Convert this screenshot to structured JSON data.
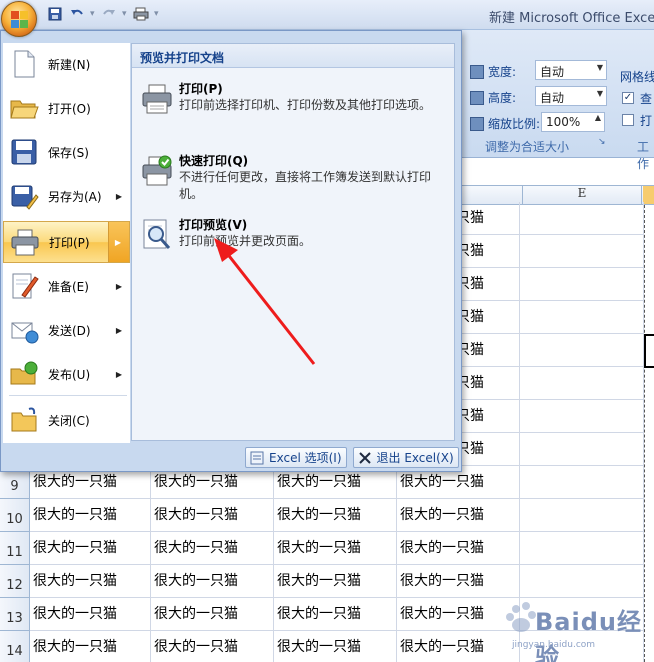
{
  "app": {
    "title": "新建 Microsoft Office Exce",
    "quick_access": [
      "save-icon",
      "undo-icon",
      "redo-icon",
      "print-icon"
    ]
  },
  "ribbon": {
    "width_label": "宽度:",
    "height_label": "高度:",
    "scale_label": "缩放比例:",
    "width_value": "自动",
    "height_value": "自动",
    "scale_value": "100%",
    "group_label": "调整为合适大小",
    "gridlines_label": "网格线",
    "view_check_label": "查",
    "print_check_label": "打",
    "group2_label": "工作"
  },
  "sheet": {
    "column_header": "E",
    "cell_text": "很大的一只猫",
    "row_numbers": [
      "9",
      "10",
      "11",
      "12",
      "13",
      "14"
    ]
  },
  "office_menu": {
    "items": [
      {
        "label": "新建(N)",
        "icon": "new-document-icon",
        "has_submenu": false
      },
      {
        "label": "打开(O)",
        "icon": "open-folder-icon",
        "has_submenu": false
      },
      {
        "label": "保存(S)",
        "icon": "save-disk-icon",
        "has_submenu": false
      },
      {
        "label": "另存为(A)",
        "icon": "save-as-icon",
        "has_submenu": true
      },
      {
        "label": "打印(P)",
        "icon": "printer-icon",
        "has_submenu": true,
        "selected": true
      },
      {
        "label": "准备(E)",
        "icon": "prepare-icon",
        "has_submenu": true
      },
      {
        "label": "发送(D)",
        "icon": "send-icon",
        "has_submenu": true
      },
      {
        "label": "发布(U)",
        "icon": "publish-icon",
        "has_submenu": true
      },
      {
        "label": "关闭(C)",
        "icon": "close-folder-icon",
        "has_submenu": false
      }
    ],
    "panel": {
      "header": "预览并打印文档",
      "options": [
        {
          "title": "打印(P)",
          "description": "打印前选择打印机、打印份数及其他打印选项。",
          "icon": "printer-icon"
        },
        {
          "title": "快速打印(Q)",
          "description": "不进行任何更改，直接将工作簿发送到默认打印机。",
          "icon": "quick-print-icon"
        },
        {
          "title": "打印预览(V)",
          "description": "打印前预览并更改页面。",
          "icon": "print-preview-icon"
        }
      ]
    },
    "footer": {
      "options_label": "Excel 选项(I)",
      "exit_label": "退出 Excel(X)"
    }
  },
  "watermark": {
    "text": "Baidu经验",
    "sub": "jingyan.baidu.com"
  },
  "colors": {
    "accent": "#15428b",
    "selected_item": "#f9c64f",
    "annotation_arrow": "#ee1c1c"
  }
}
